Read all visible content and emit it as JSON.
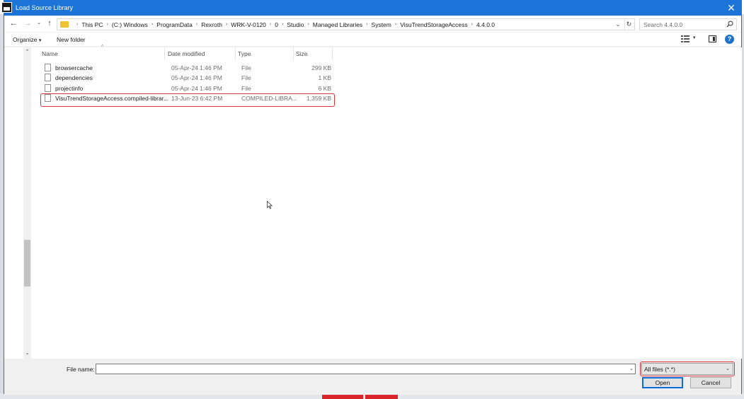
{
  "window": {
    "title": "Load Source Library"
  },
  "address": {
    "crumbs": [
      "This PC",
      "(C:) Windows",
      "ProgramData",
      "Rexroth",
      "WRK-V-0120",
      "0",
      "Studio",
      "Managed Libraries",
      "System",
      "VisuTrendStorageAccess",
      "4.4.0.0"
    ]
  },
  "search": {
    "placeholder": "Search 4.4.0.0"
  },
  "toolbar": {
    "organize_label": "Organize",
    "new_folder_label": "New folder"
  },
  "columns": {
    "name": "Name",
    "date": "Date modified",
    "type": "Type",
    "size": "Size"
  },
  "files": [
    {
      "name": "browsercache",
      "date": "05-Apr-24 1:46 PM",
      "type": "File",
      "size": "299 KB"
    },
    {
      "name": "dependencies",
      "date": "05-Apr-24 1:46 PM",
      "type": "File",
      "size": "1 KB"
    },
    {
      "name": "projectinfo",
      "date": "05-Apr-24 1:46 PM",
      "type": "File",
      "size": "6 KB"
    },
    {
      "name": "VisuTrendStorageAccess.compiled-librar...",
      "date": "13-Jun-23 6:42 PM",
      "type": "COMPILED-LIBRA...",
      "size": "1,359 KB"
    }
  ],
  "bottom": {
    "file_name_label": "File name:",
    "file_name_value": "",
    "filter_value": "All files (*.*)",
    "open_label": "Open",
    "cancel_label": "Cancel"
  },
  "colors": {
    "titlebar": "#1c74d8",
    "highlight": "#d9343a",
    "accent": "#0f6cd6"
  }
}
